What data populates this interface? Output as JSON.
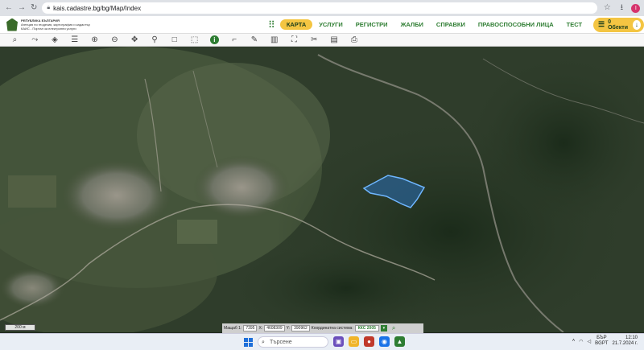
{
  "browser": {
    "url": "kais.cadastre.bg/bg/Map/Index",
    "profile_letter": "I"
  },
  "header": {
    "logo_line1": "РЕПУБЛИКА БЪЛГАРИЯ",
    "logo_line2": "Агенция по геодезия, картография и кадастър",
    "logo_line3": "КАИС - Портал за електронни услуги",
    "menu": [
      {
        "label": "КАРТА",
        "active": true
      },
      {
        "label": "УСЛУГИ",
        "active": false
      },
      {
        "label": "РЕГИСТРИ",
        "active": false
      },
      {
        "label": "ЖАЛБИ",
        "active": false
      },
      {
        "label": "СПРАВКИ",
        "active": false
      },
      {
        "label": "ПРАВОСПОСОБНИ ЛИЦА",
        "active": false
      },
      {
        "label": "ТЕСТ",
        "active": false
      }
    ],
    "objects_button": "0 Обекти"
  },
  "toolbar": {
    "tools": [
      {
        "name": "search-icon",
        "glyph": "⌕"
      },
      {
        "name": "route-icon",
        "glyph": "⤳"
      },
      {
        "name": "layers-icon",
        "glyph": "◈"
      },
      {
        "name": "layers-stack-icon",
        "glyph": "☰"
      },
      {
        "name": "zoom-in-icon",
        "glyph": "⊕"
      },
      {
        "name": "zoom-out-icon",
        "glyph": "⊖"
      },
      {
        "name": "pan-icon",
        "glyph": "✥"
      },
      {
        "name": "pin-icon",
        "glyph": "⚲"
      },
      {
        "name": "select-box-icon",
        "glyph": "□"
      },
      {
        "name": "select-area-icon",
        "glyph": "⬚"
      },
      {
        "name": "info-icon",
        "glyph": "i"
      },
      {
        "name": "measure-icon",
        "glyph": "⌐"
      },
      {
        "name": "draw-icon",
        "glyph": "✎"
      },
      {
        "name": "map-icon",
        "glyph": "▥"
      },
      {
        "name": "fullscreen-icon",
        "glyph": "⛶"
      },
      {
        "name": "cut-icon",
        "glyph": "✂"
      },
      {
        "name": "layers-panel-icon",
        "glyph": "▤"
      },
      {
        "name": "print-icon",
        "glyph": "⎙"
      }
    ]
  },
  "map": {
    "scale_label": "200 м"
  },
  "status": {
    "scale_label": "Мащаб 1:",
    "scale_value": "7395",
    "x_label": "X:",
    "x_value": "4608309",
    "y_label": "Y:",
    "y_value": "390962",
    "crs_label": "Координатна система:",
    "crs_value": "ККС 2005"
  },
  "taskbar": {
    "search_placeholder": "Търсене",
    "lang_line1": "БЪР",
    "lang_line2": "BGPT",
    "time": "12:10",
    "date": "21.7.2024 г."
  }
}
